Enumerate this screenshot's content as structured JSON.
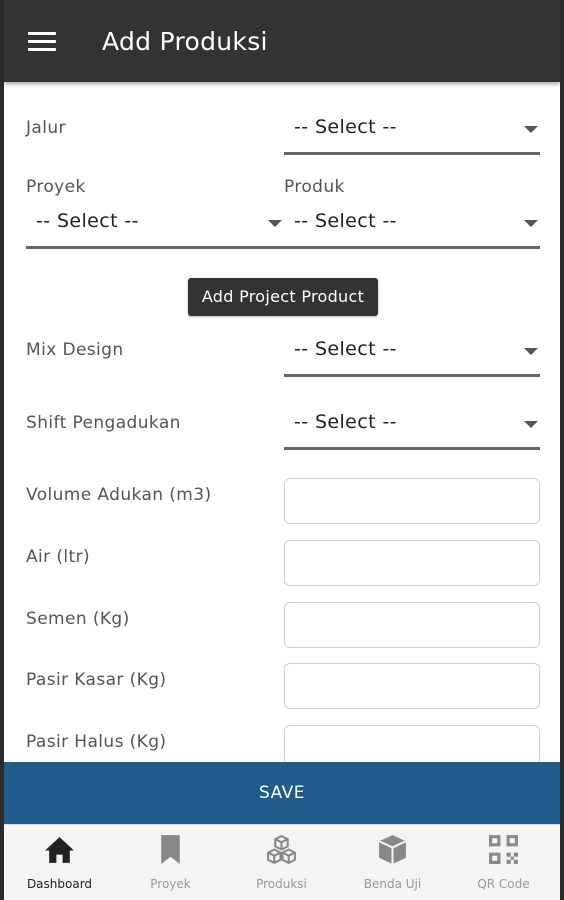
{
  "appbar": {
    "title": "Add Produksi",
    "menu_icon": "menu-icon"
  },
  "form": {
    "jalur": {
      "label": "Jalur",
      "value": "-- Select --"
    },
    "proyek": {
      "label": "Proyek",
      "value": "-- Select --"
    },
    "produk": {
      "label": "Produk",
      "value": "-- Select --"
    },
    "add_project_product": "Add Project Product",
    "mix_design": {
      "label": "Mix Design",
      "value": "-- Select --"
    },
    "shift": {
      "label": "Shift Pengadukan",
      "value": "-- Select --"
    },
    "volume": {
      "label": "Volume Adukan (m3)",
      "value": ""
    },
    "air": {
      "label": "Air (ltr)",
      "value": ""
    },
    "semen": {
      "label": "Semen (Kg)",
      "value": ""
    },
    "pasir_kasar": {
      "label": "Pasir Kasar (Kg)",
      "value": ""
    },
    "pasir_halus": {
      "label": "Pasir Halus (Kg)",
      "value": ""
    }
  },
  "save_label": "SAVE",
  "nav": {
    "items": [
      {
        "label": "Dashboard",
        "icon": "home-icon",
        "active": true
      },
      {
        "label": "Proyek",
        "icon": "bookmark-icon",
        "active": false
      },
      {
        "label": "Produksi",
        "icon": "cubes-icon",
        "active": false
      },
      {
        "label": "Benda Uji",
        "icon": "cube-icon",
        "active": false
      },
      {
        "label": "QR Code",
        "icon": "qr-code-icon",
        "active": false
      }
    ]
  }
}
